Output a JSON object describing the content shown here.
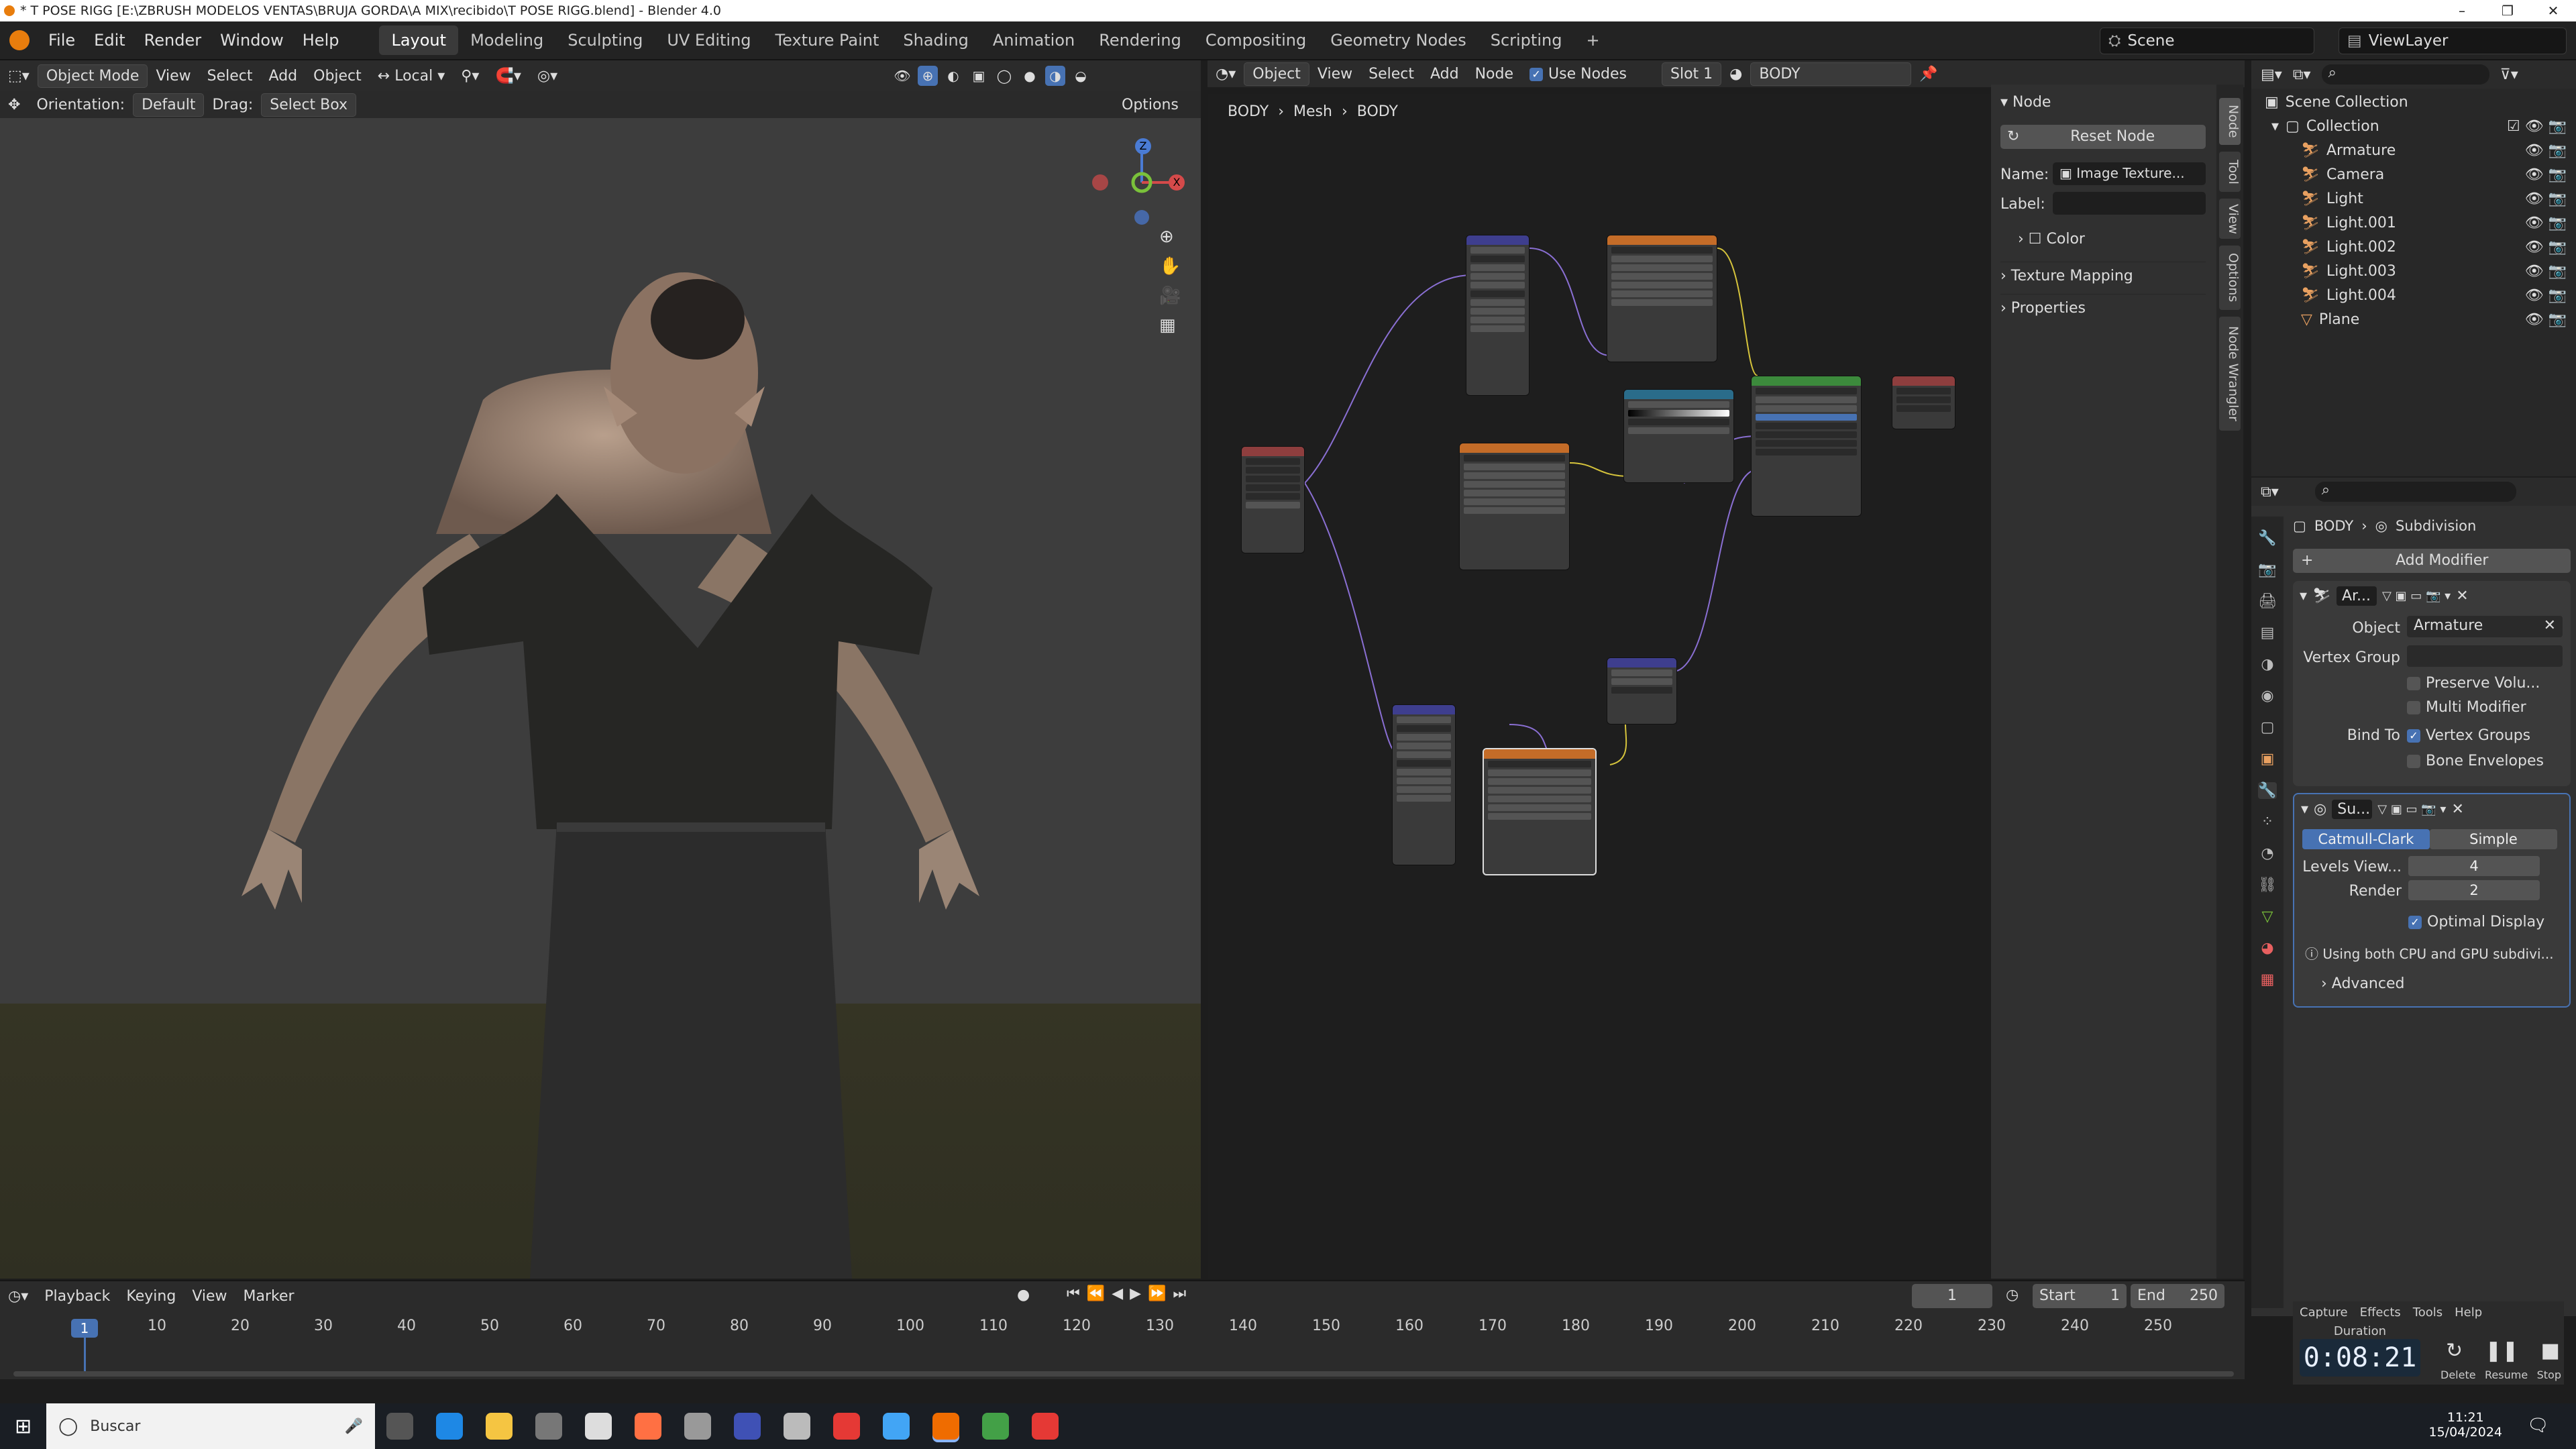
{
  "window": {
    "title": "* T POSE RIGG [E:\\ZBRUSH MODELOS VENTAS\\BRUJA GORDA\\A MIX\\recibido\\T POSE RIGG.blend] - Blender 4.0"
  },
  "menu": [
    "File",
    "Edit",
    "Render",
    "Window",
    "Help"
  ],
  "workspaces": [
    {
      "label": "Layout",
      "active": true
    },
    {
      "label": "Modeling"
    },
    {
      "label": "Sculpting"
    },
    {
      "label": "UV Editing"
    },
    {
      "label": "Texture Paint"
    },
    {
      "label": "Shading"
    },
    {
      "label": "Animation"
    },
    {
      "label": "Rendering"
    },
    {
      "label": "Compositing"
    },
    {
      "label": "Geometry Nodes"
    },
    {
      "label": "Scripting"
    }
  ],
  "scene": {
    "name": "Scene",
    "view_layer": "ViewLayer"
  },
  "viewport": {
    "mode": "Object Mode",
    "menus": [
      "View",
      "Select",
      "Add",
      "Object"
    ],
    "transform_orientation": "Local",
    "orientation_label": "Orientation:",
    "orientation_value": "Default",
    "drag_label": "Drag:",
    "drag_value": "Select Box",
    "options_label": "Options",
    "gizmo": {
      "z": "Z",
      "y": "Y",
      "x": "X"
    }
  },
  "node_editor": {
    "type": "Object",
    "menus": [
      "View",
      "Select",
      "Add",
      "Node"
    ],
    "use_nodes_label": "Use Nodes",
    "slot": "Slot 1",
    "material": "BODY",
    "breadcrumb": [
      "BODY",
      "Mesh",
      "BODY"
    ]
  },
  "node_panel": {
    "section": "Node",
    "reset_label": "Reset Node",
    "name_label": "Name:",
    "name_value": "Image Texture...",
    "label_label": "Label:",
    "color_label": "Color",
    "texture_mapping": "Texture Mapping",
    "properties": "Properties",
    "vertical_tabs": [
      "Node",
      "Tool",
      "View",
      "Options",
      "Node Wrangler"
    ]
  },
  "outliner": {
    "root": "Scene Collection",
    "collection": "Collection",
    "items": [
      "Armature",
      "Camera",
      "Light",
      "Light.001",
      "Light.002",
      "Light.003",
      "Light.004",
      "Plane"
    ]
  },
  "properties": {
    "breadcrumb_object": "BODY",
    "breadcrumb_modifier": "Subdivision",
    "add_modifier": "Add Modifier",
    "armature_mod": {
      "name": "Ar...",
      "object_label": "Object",
      "object_value": "Armature",
      "vertex_group_label": "Vertex Group",
      "preserve_volume": "Preserve Volu...",
      "multi_modifier": "Multi Modifier",
      "bind_to_label": "Bind To",
      "vertex_groups": "Vertex Groups",
      "bone_envelopes": "Bone Envelopes"
    },
    "subsurf_mod": {
      "name": "Su...",
      "catmull": "Catmull-Clark",
      "simple": "Simple",
      "levels_label": "Levels View...",
      "levels_value": "4",
      "render_label": "Render",
      "render_value": "2",
      "optimal": "Optimal Display",
      "info": "Using both CPU and GPU subdivi...",
      "advanced": "Advanced"
    }
  },
  "timeline": {
    "menus": [
      "Playback",
      "Keying",
      "View",
      "Marker"
    ],
    "current_frame": "1",
    "start_label": "Start",
    "start": "1",
    "end_label": "End",
    "end": "250",
    "ruler": [
      "10",
      "20",
      "30",
      "40",
      "50",
      "60",
      "70",
      "80",
      "90",
      "100",
      "110",
      "120",
      "130",
      "140",
      "150",
      "160",
      "170",
      "180",
      "190",
      "200",
      "210",
      "220",
      "230",
      "240",
      "250"
    ]
  },
  "capture": {
    "tabs": [
      "Capture",
      "Effects",
      "Tools",
      "Help"
    ],
    "duration_label": "Duration",
    "time": "0:08:21",
    "buttons": [
      "Delete",
      "Resume",
      "Stop"
    ]
  },
  "taskbar": {
    "search": "Buscar",
    "time": "11:21",
    "date": "15/04/2024"
  }
}
